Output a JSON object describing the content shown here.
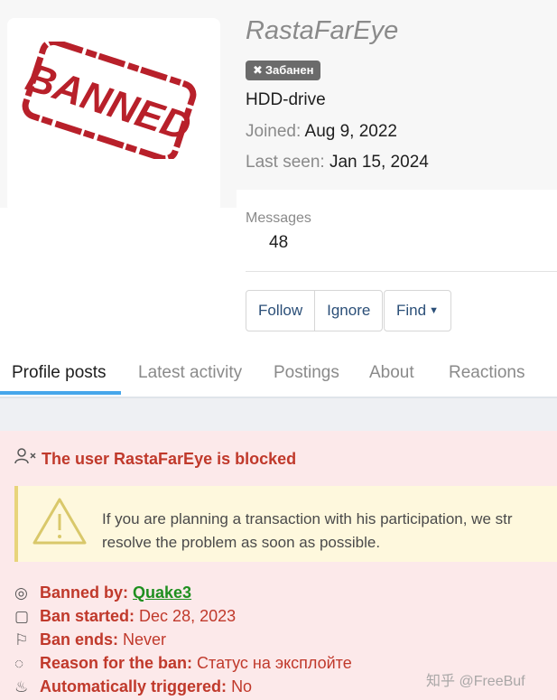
{
  "profile": {
    "username": "RastaFarEye",
    "badge": "Забанен",
    "user_title": "HDD-drive",
    "joined_label": "Joined:",
    "joined_value": "Aug 9, 2022",
    "last_seen_label": "Last seen:",
    "last_seen_value": "Jan 15, 2024",
    "messages_label": "Messages",
    "messages_count": "48",
    "avatar_stamp_text": "BANNED",
    "stamp_color": "#b8202a"
  },
  "buttons": {
    "follow": "Follow",
    "ignore": "Ignore",
    "find": "Find"
  },
  "tabs": [
    {
      "label": "Profile posts",
      "active": true
    },
    {
      "label": "Latest activity",
      "active": false
    },
    {
      "label": "Postings",
      "active": false
    },
    {
      "label": "About",
      "active": false
    },
    {
      "label": "Reactions",
      "active": false
    }
  ],
  "blocked": {
    "heading": "The user RastaFarEye is blocked",
    "warning_line1": "If you are planning a transaction with his participation, we str",
    "warning_line2": "resolve the problem as soon as possible.",
    "banned_by_label": "Banned by:",
    "banned_by_value": "Quake3",
    "ban_started_label": "Ban started:",
    "ban_started_value": "Dec 28, 2023",
    "ban_ends_label": "Ban ends:",
    "ban_ends_value": "Never",
    "reason_label": "Reason for the ban:",
    "reason_value": "Статус на эксплойте",
    "auto_label": "Automatically triggered:",
    "auto_value": "No"
  },
  "watermark": "知乎 @FreeBuf",
  "colors": {
    "accent": "#47a7eb",
    "danger": "#c0392b",
    "link_green": "#1f8f1f",
    "warning_bg": "#fef8dd"
  }
}
